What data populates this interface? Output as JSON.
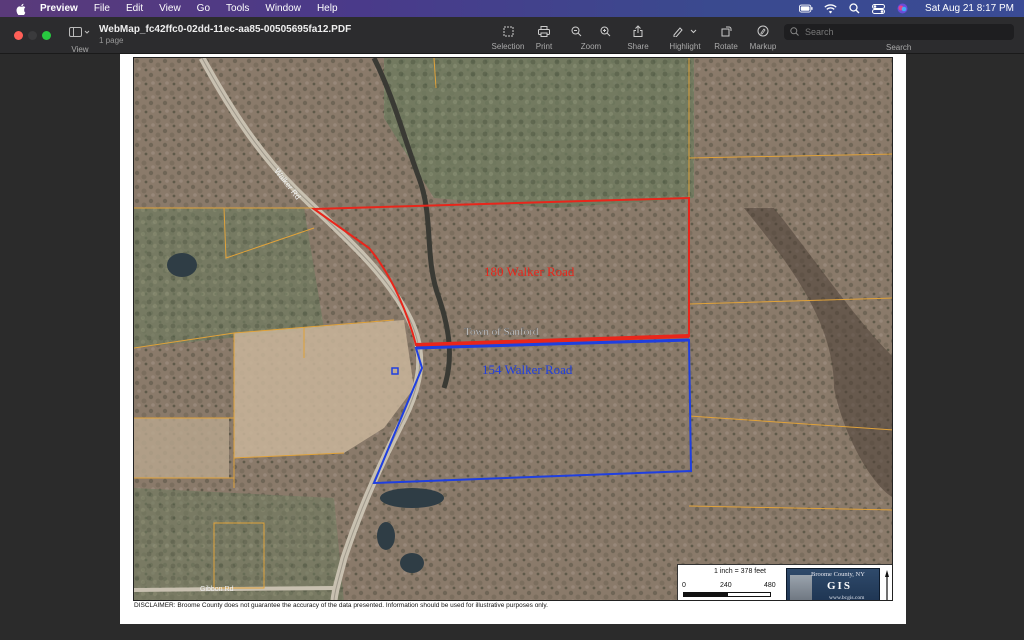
{
  "menubar": {
    "app_name": "Preview",
    "items": [
      "File",
      "Edit",
      "View",
      "Go",
      "Tools",
      "Window",
      "Help"
    ],
    "clock": "Sat Aug 21  8:17 PM"
  },
  "toolbar": {
    "view_label": "View",
    "doc_title": "WebMap_fc42ffc0-02dd-11ec-aa85-00505695fa12.PDF",
    "doc_pages": "1 page",
    "tools": [
      {
        "label": "Selection",
        "icon": "selection-icon"
      },
      {
        "label": "Print",
        "icon": "print-icon"
      },
      {
        "label": "Zoom",
        "icon": "zoom-icon"
      },
      {
        "label": "Share",
        "icon": "share-icon"
      },
      {
        "label": "Highlight",
        "icon": "highlight-icon"
      },
      {
        "label": "Rotate",
        "icon": "rotate-icon"
      },
      {
        "label": "Markup",
        "icon": "markup-icon"
      }
    ],
    "search_placeholder": "Search",
    "search_label": "Search"
  },
  "map": {
    "labels": {
      "parcel_red": "180 Walker Road",
      "parcel_blue": "154 Walker Road",
      "town": "Town of Sanford",
      "road_main": "Walker Rd",
      "road_south": "Gibbon Rd"
    },
    "colors": {
      "parcel_red": "#e8261b",
      "parcel_blue": "#1f3fe0",
      "parcel_lines": "#e0a23a"
    }
  },
  "legend": {
    "scale_text": "1 inch = 378 feet",
    "ticks": [
      "0",
      "240",
      "480"
    ],
    "unit": "ft",
    "org": "Broome County, NY",
    "gis": "GIS",
    "url": "www.bcgis.com"
  },
  "disclaimer": "DISCLAIMER:  Broome County does not guarantee the accuracy of the data presented.  Information should be used for illustrative purposes only."
}
